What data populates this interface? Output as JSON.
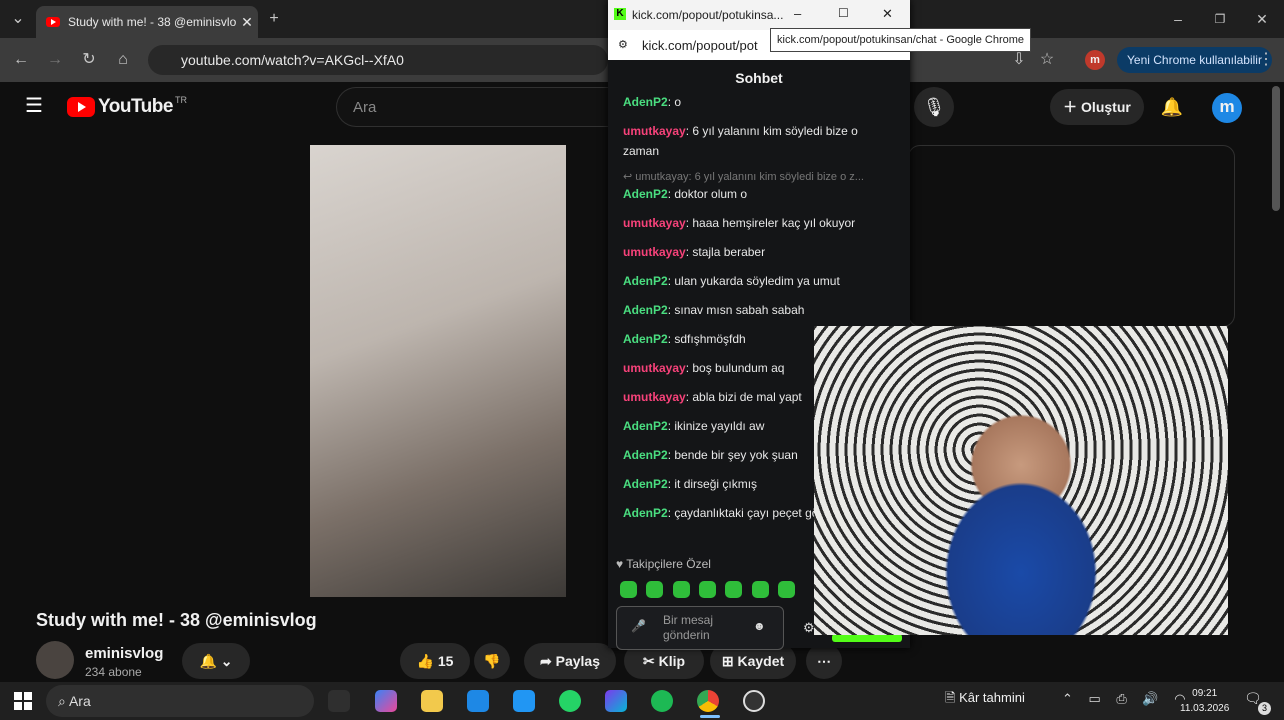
{
  "browser": {
    "tab_title": "Study with me! - 38 @eminisvlog",
    "new_tab_symbol": "+",
    "url": "youtube.com/watch?v=AKGcl--XfA0",
    "profile_pill": "Yeni Chrome kullanılabilir",
    "profile_letter": "m"
  },
  "youtube": {
    "logo_text": "YouTube",
    "region": "TR",
    "search_placeholder": "Ara",
    "create_label": "Oluştur",
    "avatar_letter": "m",
    "video_title": "Study with me! - 38 @eminisvlog",
    "channel_name": "eminisvlog",
    "subscribers": "234 abone",
    "like_count": "15",
    "share_label": "Paylaş",
    "clip_label": "Klip",
    "save_label": "Kaydet"
  },
  "kick": {
    "window_title": "kick.com/popout/potukinsa...",
    "url": "kick.com/popout/pot",
    "tooltip": "kick.com/popout/potukinsan/chat - Google Chrome",
    "chat_header": "Sohbet",
    "messages": [
      {
        "user": "AdenP2",
        "text": "o"
      },
      {
        "user": "umutkayay",
        "text": "6 yıl yalanını kim söyledi bize o zaman"
      },
      {
        "reply": "umutkayay: 6 yıl yalanını kim söyledi bize o z..."
      },
      {
        "user": "AdenP2",
        "text": "doktor olum o"
      },
      {
        "user": "umutkayay",
        "text": "haaa hemşireler kaç yıl okuyor"
      },
      {
        "user": "umutkayay",
        "text": "stajla beraber"
      },
      {
        "user": "AdenP2",
        "text": "ulan yukarda söyledim ya umut"
      },
      {
        "user": "AdenP2",
        "text": "sınav mısn sabah sabah"
      },
      {
        "user": "AdenP2",
        "text": "sdfışhmöşfdh"
      },
      {
        "user": "umutkayay",
        "text": "boş bulundum aq"
      },
      {
        "user": "umutkayay",
        "text": "abla bizi de mal yapt"
      },
      {
        "user": "AdenP2",
        "text": "ikinize yayıldı aw"
      },
      {
        "user": "AdenP2",
        "text": "bende bir şey yok şuan"
      },
      {
        "user": "AdenP2",
        "text": "it dirseği çıkmış"
      },
      {
        "user": "AdenP2",
        "text": "çaydanlıktaki çayı peçet gözüne bastır"
      }
    ],
    "followers_only": "Takipçilere Özel",
    "message_placeholder": "Bir mesaj gönderin"
  },
  "taskbar": {
    "search_placeholder": "Ara",
    "weather": "Kâr tahmini",
    "time": "09:21",
    "date": "11.03.2026",
    "notif_count": "3"
  },
  "colors": {
    "kick_green": "#53fc18",
    "yt_red": "#ff0000",
    "user_green": "#4ade80",
    "user_pink": "#f7427a"
  }
}
